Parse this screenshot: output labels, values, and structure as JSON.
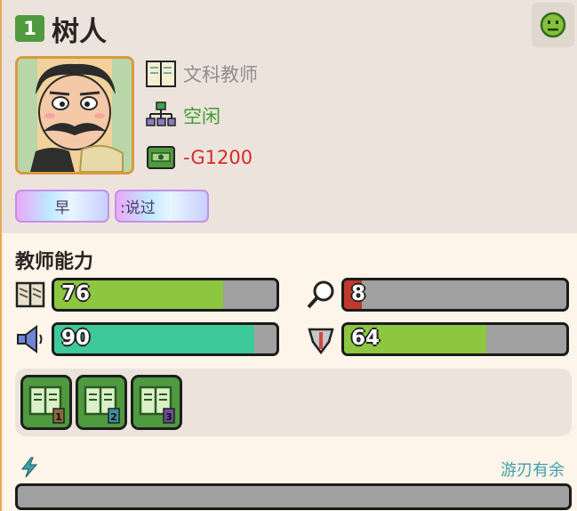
{
  "header": {
    "level": "1",
    "name": "树人"
  },
  "mood_icon": "smiley-face-icon",
  "info": {
    "major": "文科教师",
    "state": "空闲",
    "money": "-G1200"
  },
  "tags": [
    "早",
    ":说过"
  ],
  "abilities": {
    "title": "教师能力",
    "stats": [
      {
        "icon": "book-stack-icon",
        "value": "76",
        "fill": 0.76,
        "color": "#8dc63f"
      },
      {
        "icon": "magnifier-icon",
        "value": "8",
        "fill": 0.08,
        "color": "#c0392b"
      },
      {
        "icon": "speaker-icon",
        "value": "90",
        "fill": 0.9,
        "color": "#3ec99a"
      },
      {
        "icon": "shield-icon",
        "value": "64",
        "fill": 0.64,
        "color": "#8dc63f"
      }
    ]
  },
  "books": [
    {
      "icon": "book-level-1-icon",
      "level": "1"
    },
    {
      "icon": "book-level-2-icon",
      "level": "2"
    },
    {
      "icon": "book-level-3-icon",
      "level": "3"
    }
  ],
  "energy": {
    "label": "游刃有余",
    "icon": "lightning-icon"
  }
}
